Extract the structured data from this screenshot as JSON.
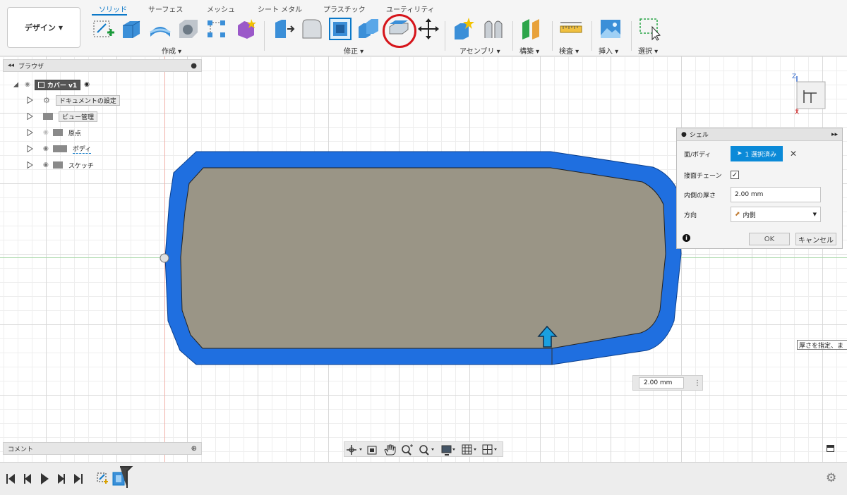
{
  "toolbar": {
    "workspace_label": "デザイン",
    "tabs": [
      "ソリッド",
      "サーフェス",
      "メッシュ",
      "シート メタル",
      "プラスチック",
      "ユーティリティ"
    ],
    "groups": {
      "create": "作成",
      "modify": "修正",
      "assemble": "アセンブリ",
      "construct": "構築",
      "inspect": "検査",
      "insert": "挿入",
      "select": "選択"
    },
    "highlight_color": "#d6151b",
    "accent_color": "#0b78c8"
  },
  "browser": {
    "title": "ブラウザ",
    "root": "カバー v1",
    "items": [
      "ドキュメントの設定",
      "ビュー管理",
      "原点",
      "ボディ",
      "スケッチ"
    ]
  },
  "comment_panel": {
    "title": "コメント"
  },
  "shell_dialog": {
    "title": "シェル",
    "rows": {
      "faces_label": "面/ボディ",
      "faces_value": "1 選択済み",
      "tangent_chain_label": "接面チェーン",
      "tangent_chain_checked": true,
      "inside_thickness_label": "内側の厚さ",
      "inside_thickness_value": "2.00 mm",
      "direction_label": "方向",
      "direction_value": "内側"
    },
    "ok_label": "OK",
    "cancel_label": "キャンセル"
  },
  "canvas": {
    "dimension_input": "2.00 mm",
    "tooltip": "厚さを指定、ま",
    "body_color": "#9a9586",
    "shell_color": "#1f6fe0"
  },
  "viewcube": {
    "axis_z": "Z",
    "axis_x": "X"
  }
}
